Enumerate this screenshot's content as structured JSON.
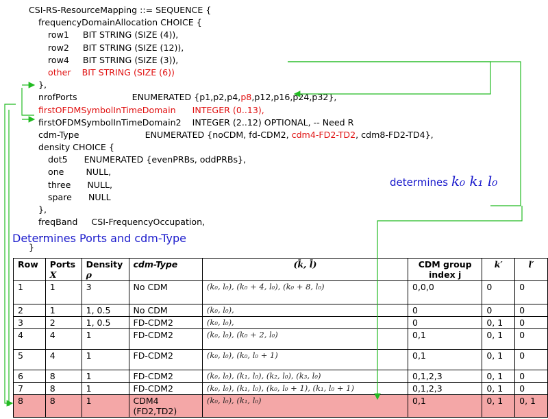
{
  "code_lines": [
    {
      "indent": 0,
      "text": "CSI-RS-ResourceMapping ::= SEQUENCE {",
      "red": false
    },
    {
      "indent": 1,
      "text": "frequencyDomainAllocation CHOICE {",
      "red": false
    },
    {
      "indent": 2,
      "text": "row1     BIT STRING (SIZE (4)),",
      "red": false
    },
    {
      "indent": 2,
      "text": "row2     BIT STRING (SIZE (12)),",
      "red": false
    },
    {
      "indent": 2,
      "text": "row4     BIT STRING (SIZE (3)),",
      "red": false
    },
    {
      "indent": 2,
      "text": "other    BIT STRING (SIZE (6))",
      "red": true
    },
    {
      "indent": 1,
      "text": "},",
      "red": false
    },
    {
      "indent": 1,
      "parts": [
        {
          "t": "nrofPorts                    ENUMERATED {p1,p2,p4,",
          "red": false
        },
        {
          "t": "p8",
          "red": true
        },
        {
          "t": ",p12,p16,p24,p32},",
          "red": false
        }
      ]
    },
    {
      "indent": 1,
      "text": "firstOFDMSymbolInTimeDomain      INTEGER (0..13),",
      "red": true
    },
    {
      "indent": 1,
      "text": "firstOFDMSymbolInTimeDomain2    INTEGER (2..12) OPTIONAL, -- Need R",
      "red": false
    },
    {
      "indent": 1,
      "parts": [
        {
          "t": "cdm-Type                        ENUMERATED {noCDM, fd-CDM2, ",
          "red": false
        },
        {
          "t": "cdm4-FD2-TD2",
          "red": true
        },
        {
          "t": ", cdm8-FD2-TD4},",
          "red": false
        }
      ]
    },
    {
      "indent": 1,
      "text": "density CHOICE {",
      "red": false
    },
    {
      "indent": 2,
      "text": "dot5      ENUMERATED {evenPRBs, oddPRBs},",
      "red": false
    },
    {
      "indent": 2,
      "text": "one        NULL,",
      "red": false
    },
    {
      "indent": 2,
      "text": "three      NULL,",
      "red": false
    },
    {
      "indent": 2,
      "text": "spare      NULL",
      "red": false
    },
    {
      "indent": 1,
      "text": "},",
      "red": false
    },
    {
      "indent": 1,
      "text": "freqBand     CSI-FrequencyOccupation,",
      "red": false
    },
    {
      "indent": 1,
      "text": "...",
      "red": false
    },
    {
      "indent": 0,
      "text": "}",
      "red": false
    }
  ],
  "annotations": {
    "determines_text": "determines",
    "determines_math": "k₀ k₁ l₀",
    "subtitle": "Determines Ports and cdm-Type"
  },
  "table": {
    "headers": [
      {
        "line1": "Row",
        "line2": ""
      },
      {
        "line1": "Ports",
        "line2": "X"
      },
      {
        "line1": "Density",
        "line2": "ρ"
      },
      {
        "line1": "cdm-Type",
        "line2": ""
      },
      {
        "line1": "(k̄, l̄)",
        "line2": ""
      },
      {
        "line1": "CDM group",
        "line2": "index j"
      },
      {
        "line1": "k′",
        "line2": ""
      },
      {
        "line1": "l′",
        "line2": ""
      }
    ],
    "rows": [
      {
        "row": "1",
        "ports": "1",
        "density": "3",
        "cdm": "No CDM",
        "kl": "(k₀, l₀), (k₀ + 4, l₀), (k₀ + 8, l₀)",
        "j": "0,0,0",
        "kp": "0",
        "lp": "0",
        "h": 34,
        "hl": false
      },
      {
        "row": "2",
        "ports": "1",
        "density": "1, 0.5",
        "cdm": "No CDM",
        "kl": "(k₀, l₀),",
        "j": "0",
        "kp": "0",
        "lp": "0",
        "h": 15,
        "hl": false
      },
      {
        "row": "3",
        "ports": "2",
        "density": "1, 0.5",
        "cdm": "FD-CDM2",
        "kl": "(k₀, l₀),",
        "j": "0",
        "kp": "0, 1",
        "lp": "0",
        "h": 15,
        "hl": false
      },
      {
        "row": "4",
        "ports": "4",
        "density": "1",
        "cdm": "FD-CDM2",
        "kl": "(k₀, l₀), (k₀ + 2, l₀)",
        "j": "0,1",
        "kp": "0, 1",
        "lp": "0",
        "h": 30,
        "hl": false
      },
      {
        "row": "5",
        "ports": "4",
        "density": "1",
        "cdm": "FD-CDM2",
        "kl": "(k₀, l₀), (k₀, l₀ + 1)",
        "j": "0,1",
        "kp": "0, 1",
        "lp": "0",
        "h": 30,
        "hl": false
      },
      {
        "row": "6",
        "ports": "8",
        "density": "1",
        "cdm": "FD-CDM2",
        "kl": "(k₀, l₀), (k₁, l₀), (k₂, l₀), (k₃, l₀)",
        "j": "0,1,2,3",
        "kp": "0, 1",
        "lp": "0",
        "h": 15,
        "hl": false
      },
      {
        "row": "7",
        "ports": "8",
        "density": "1",
        "cdm": "FD-CDM2",
        "kl": "(k₀, l₀), (k₁, l₀), (k₀, l₀ + 1), (k₁, l₀ + 1)",
        "j": "0,1,2,3",
        "kp": "0, 1",
        "lp": "0",
        "h": 15,
        "hl": false
      },
      {
        "row": "8",
        "ports": "8",
        "density": "1",
        "cdm": "CDM4\n(FD2,TD2)",
        "kl": "(k₀, l₀), (k₁, l₀)",
        "j": "0,1",
        "kp": "0, 1",
        "lp": "0, 1",
        "h": 30,
        "hl": true
      }
    ]
  }
}
